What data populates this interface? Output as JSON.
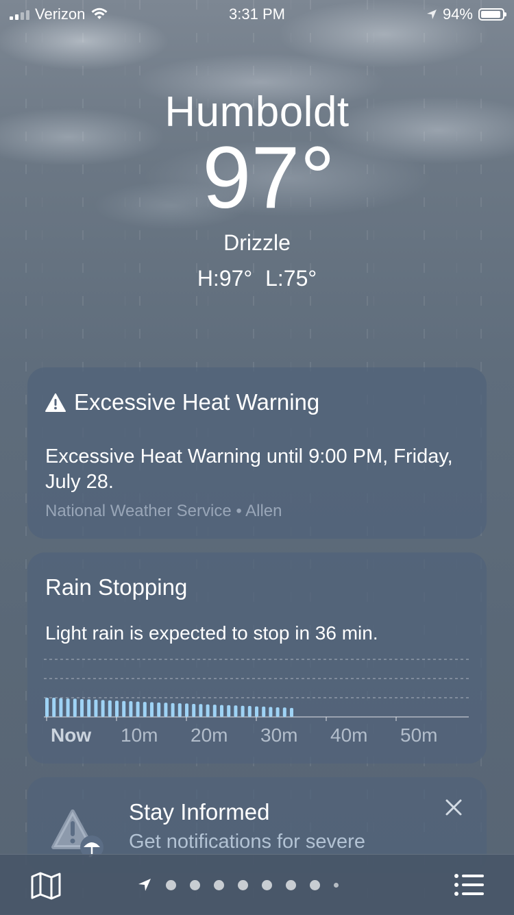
{
  "status_bar": {
    "carrier": "Verizon",
    "time": "3:31 PM",
    "battery_percent": "94%",
    "battery_level": 0.94
  },
  "header": {
    "city": "Humboldt",
    "temperature": "97°",
    "condition": "Drizzle",
    "high_low": "H:97°  L:75°"
  },
  "alert_card": {
    "title": "Excessive Heat Warning",
    "body": "Excessive Heat Warning until 9:00 PM, Friday, July 28.",
    "source": "National Weather Service • Allen",
    "icon": "warning-triangle-icon"
  },
  "rain_card": {
    "title": "Rain Stopping",
    "summary": "Light rain is expected to stop in 36 min.",
    "tick_labels": [
      "Now",
      "10m",
      "20m",
      "30m",
      "40m",
      "50m"
    ]
  },
  "chart_data": {
    "type": "bar",
    "title": "Rain Stopping",
    "x_unit": "minutes",
    "categories": [
      "Now",
      "10m",
      "20m",
      "30m",
      "40m",
      "50m"
    ],
    "values": [
      1.0,
      1.0,
      0.98,
      0.96,
      0.95,
      0.93,
      0.92,
      0.9,
      0.88,
      0.86,
      0.85,
      0.83,
      0.82,
      0.8,
      0.78,
      0.77,
      0.75,
      0.74,
      0.72,
      0.71,
      0.7,
      0.68,
      0.67,
      0.65,
      0.64,
      0.62,
      0.61,
      0.6,
      0.58,
      0.57,
      0.55,
      0.54,
      0.52,
      0.5,
      0.49,
      0.47
    ],
    "ylim": [
      0,
      3
    ],
    "gridlines": 3,
    "bar_color": "#9fd3f5"
  },
  "stay_card": {
    "title": "Stay Informed",
    "body": "Get notifications for severe",
    "icon": "alert-umbrella-icon"
  },
  "bottom_bar": {
    "page_dots": 9,
    "active_page": "location",
    "left_icon": "map-icon",
    "right_icon": "list-icon"
  }
}
